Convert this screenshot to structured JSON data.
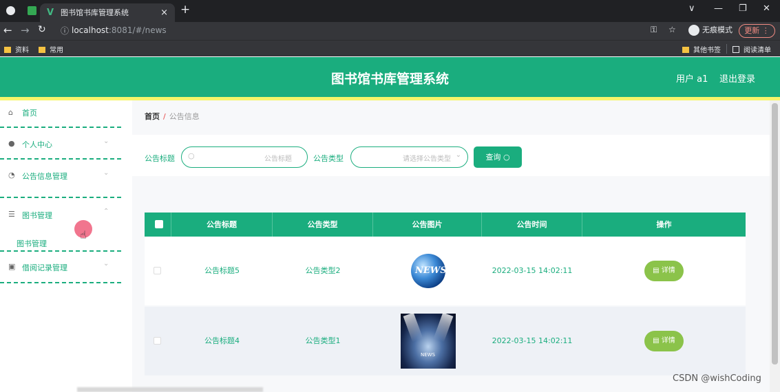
{
  "browser": {
    "tab_title": "图书馆书库管理系统",
    "tab_close": "×",
    "new_tab": "+",
    "url_host": "localhost",
    "url_rest": ":8081/#/news",
    "incognito_label": "无痕模式",
    "update_label": "更新",
    "bookmarks": [
      "资料",
      "常用"
    ],
    "bookmarks_right": [
      "其他书签",
      "阅读清单"
    ]
  },
  "header": {
    "title": "图书馆书库管理系统",
    "user": "用户 a1",
    "logout": "退出登录"
  },
  "sidebar": {
    "items": [
      {
        "label": "首页",
        "icon": "home-icon"
      },
      {
        "label": "个人中心",
        "icon": "user-icon"
      },
      {
        "label": "公告信息管理",
        "icon": "gauge-icon"
      },
      {
        "label": "图书管理",
        "icon": "menu-lines-icon"
      },
      {
        "label": "借阅记录管理",
        "icon": "calendar-icon"
      }
    ],
    "sub_item": "图书管理"
  },
  "breadcrumb": {
    "home": "首页",
    "sep": "/",
    "current": "公告信息"
  },
  "search": {
    "title_label": "公告标题",
    "title_placeholder": "公告标题",
    "type_label": "公告类型",
    "type_placeholder": "请选择公告类型",
    "query_button": "查询"
  },
  "table": {
    "headers": [
      "公告标题",
      "公告类型",
      "公告图片",
      "公告时间",
      "操作"
    ],
    "rows": [
      {
        "title": "公告标题5",
        "type": "公告类型2",
        "image": "news-globe-image",
        "time": "2022-03-15 14:02:11",
        "action": "详情"
      },
      {
        "title": "公告标题4",
        "type": "公告类型1",
        "image": "stage-lights-image",
        "time": "2022-03-15 14:02:11",
        "action": "详情"
      }
    ]
  },
  "watermark": "CSDN @wishCoding",
  "colors": {
    "accent": "#1aad7e",
    "detail": "#8bc34a",
    "stripe": "#f5f56a"
  }
}
